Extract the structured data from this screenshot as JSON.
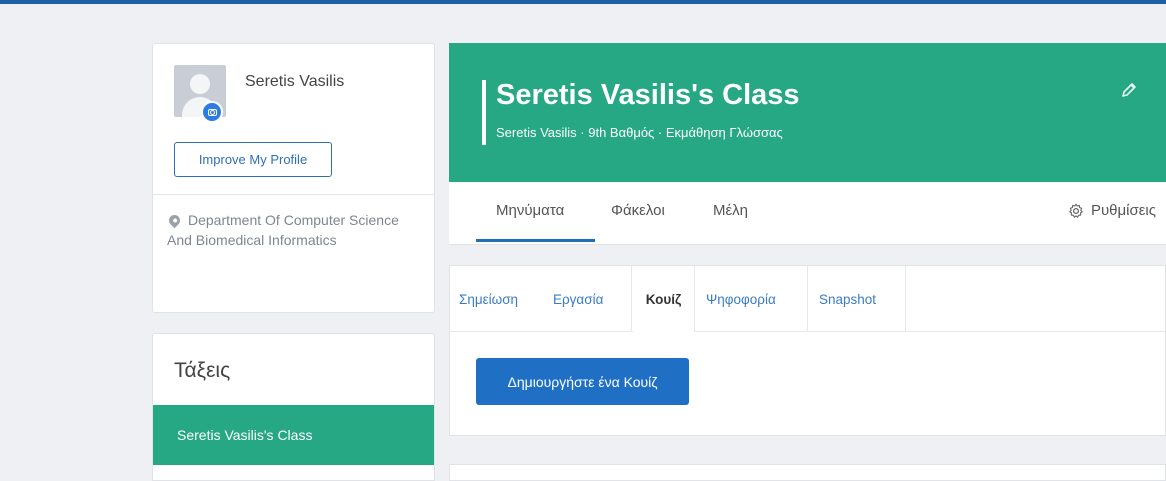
{
  "profile": {
    "name": "Seretis Vasilis",
    "improve_label": "Improve My Profile",
    "department": "Department Of Computer Science And Biomedical Informatics"
  },
  "classes": {
    "title": "Τάξεις",
    "items": [
      {
        "label": "Seretis Vasilis's Class"
      }
    ]
  },
  "class_header": {
    "title": "Seretis Vasilis's Class",
    "subtitle": "Seretis Vasilis · 9th Βαθμός · Εκμάθηση Γλώσσας"
  },
  "nav": {
    "tabs": [
      {
        "label": "Μηνύματα"
      },
      {
        "label": "Φάκελοι"
      },
      {
        "label": "Μέλη"
      }
    ],
    "settings_label": "Ρυθμίσεις"
  },
  "post_tabs": {
    "tabs": [
      {
        "label": "Σημείωση"
      },
      {
        "label": "Εργασία"
      },
      {
        "label": "Κουίζ"
      },
      {
        "label": "Ψηφοφορία"
      },
      {
        "label": "Snapshot"
      }
    ],
    "create_quiz_label": "Δημιουργήστε ένα Κουίζ"
  },
  "colors": {
    "brand_green": "#25a883",
    "primary_blue": "#1f6fc5",
    "top_bar": "#1f5fa8"
  }
}
